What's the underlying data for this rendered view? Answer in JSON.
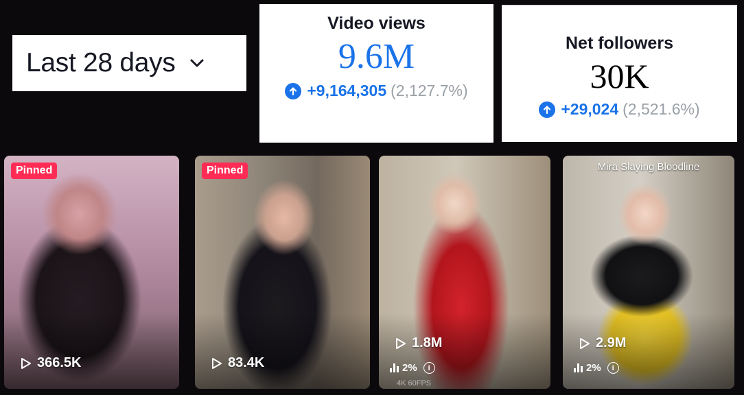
{
  "date_range": {
    "label": "Last 28 days",
    "icon": "chevron-down-icon"
  },
  "metrics": {
    "video_views": {
      "title": "Video views",
      "value": "9.6M",
      "delta": "+9,164,305",
      "delta_pct": "(2,127.7%)",
      "icon": "arrow-up-icon"
    },
    "net_followers": {
      "title": "Net followers",
      "value": "30K",
      "delta": "+29,024",
      "delta_pct": "(2,521.6%)",
      "icon": "arrow-up-icon"
    }
  },
  "videos": [
    {
      "badge": "Pinned",
      "views": "366.5K"
    },
    {
      "badge": "Pinned",
      "views": "83.4K"
    },
    {
      "views": "1.8M",
      "engagement": "2%",
      "overlay_text": "4K 60FPS"
    },
    {
      "caption": "Mira Slaying Bloodline",
      "views": "2.9M",
      "engagement": "2%"
    }
  ],
  "colors": {
    "accent_blue": "#1a73e8",
    "pinned_red": "#fe2c55",
    "muted_gray": "#9aa0a6",
    "background": "#0c090d"
  }
}
